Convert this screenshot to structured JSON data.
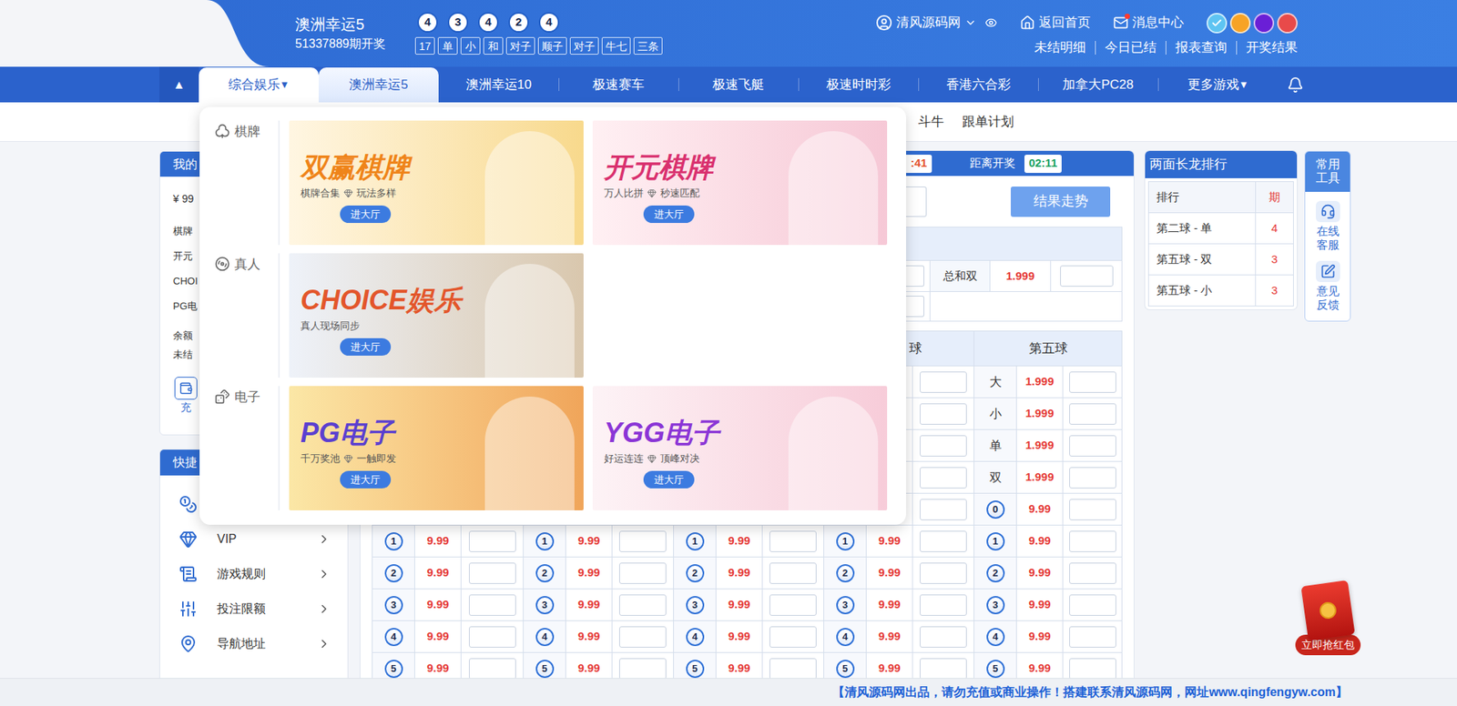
{
  "header": {
    "game_title": "澳洲幸运5",
    "draw_info": "51337889期开奖",
    "balls": [
      "4",
      "3",
      "4",
      "2",
      "4"
    ],
    "tags": [
      "17",
      "单",
      "小",
      "和",
      "对子",
      "顺子",
      "对子",
      "牛七",
      "三条"
    ],
    "user": "清风源码网",
    "home": "返回首页",
    "messages": "消息中心",
    "message_unread": true,
    "themes": [
      {
        "color": "#5ec4f2",
        "selected": true
      },
      {
        "color": "#f7a325",
        "selected": false
      },
      {
        "color": "#6a1fd6",
        "selected": false
      },
      {
        "color": "#e84a4a",
        "selected": false
      }
    ],
    "quick_links": [
      "未结明细",
      "今日已结",
      "报表查询",
      "开奖结果"
    ]
  },
  "nav": {
    "toggle": "▲",
    "items": [
      {
        "label": "综合娱乐",
        "arrow": "▼",
        "selected": false,
        "expanded": true
      },
      {
        "label": "澳洲幸运5",
        "selected": true
      },
      {
        "label": "澳洲幸运10",
        "selected": false
      },
      {
        "label": "极速赛车",
        "selected": false
      },
      {
        "label": "极速飞艇",
        "selected": false
      },
      {
        "label": "极速时时彩",
        "selected": false
      },
      {
        "label": "香港六合彩",
        "selected": false
      },
      {
        "label": "加拿大PC28",
        "selected": false
      },
      {
        "label": "更多游戏",
        "arrow": "▼",
        "selected": false,
        "expanded": false
      }
    ]
  },
  "subnav": [
    "斗牛",
    "跟单计划"
  ],
  "sidebar": {
    "account": {
      "title": "我的",
      "balance": "¥ 99",
      "games": [
        "棋牌",
        "开元",
        "CHOI",
        "PG电"
      ],
      "summary": [
        "余额",
        "未结"
      ],
      "recharge": "充"
    },
    "shortcuts": {
      "title": "快捷",
      "items": [
        {
          "kind": "coins"
        },
        {
          "kind": "vip",
          "label": "VIP"
        },
        {
          "kind": "rules",
          "label": "游戏规则"
        },
        {
          "kind": "limits",
          "label": "投注限额"
        },
        {
          "kind": "navigation",
          "label": "导航地址"
        }
      ]
    }
  },
  "dropdown": {
    "open": true,
    "categories": [
      {
        "kind": "cards",
        "label": "棋牌",
        "banners": [
          {
            "title": "双赢棋牌",
            "subtitle": [
              "棋牌合集",
              "玩法多样"
            ],
            "button": "进大厅",
            "color": "#ef8419"
          },
          {
            "title": "开元棋牌",
            "subtitle": [
              "万人比拼",
              "秒速匹配"
            ],
            "button": "进大厅",
            "color": "#d9306e"
          }
        ]
      },
      {
        "kind": "live",
        "label": "真人",
        "banners": [
          {
            "title": "CHOICE娱乐",
            "subtitle": [
              "真人现场同步"
            ],
            "button": "进大厅",
            "color": "#e3562b"
          }
        ]
      },
      {
        "kind": "slots",
        "label": "电子",
        "banners": [
          {
            "title": "PG电子",
            "subtitle": [
              "千万奖池",
              "一触即发"
            ],
            "button": "进大厅",
            "color": "#5a3fd0"
          },
          {
            "title": "YGG电子",
            "subtitle": [
              "好运连连",
              "顶峰对决"
            ],
            "button": "进大厅",
            "color": "#8b35d6"
          }
        ]
      }
    ]
  },
  "countdown": {
    "close_tail": ":41",
    "label": "距离开奖",
    "time": "02:11"
  },
  "trend_button": "结果走势",
  "totals": [
    {
      "label": "总和双",
      "odds": "1.999"
    }
  ],
  "bet_table": {
    "columns": [
      "",
      "",
      "",
      "球",
      "第五球"
    ],
    "rows": [
      {
        "kind": "text",
        "cells": [
          null,
          null,
          null,
          null,
          {
            "label": "大",
            "odds": "1.999"
          }
        ]
      },
      {
        "kind": "text",
        "cells": [
          null,
          null,
          null,
          null,
          {
            "label": "小",
            "odds": "1.999"
          }
        ]
      },
      {
        "kind": "text",
        "cells": [
          null,
          null,
          null,
          null,
          {
            "label": "单",
            "odds": "1.999"
          }
        ]
      },
      {
        "kind": "text",
        "cells": [
          null,
          null,
          null,
          null,
          {
            "label": "双",
            "odds": "1.999"
          }
        ]
      },
      {
        "kind": "ball",
        "cells": [
          null,
          null,
          null,
          null,
          {
            "label": "0",
            "odds": "9.99"
          }
        ]
      },
      {
        "kind": "ball",
        "cells": [
          {
            "label": "1",
            "odds": "9.99"
          },
          {
            "label": "1",
            "odds": "9.99"
          },
          {
            "label": "1",
            "odds": "9.99"
          },
          {
            "label": "1",
            "odds": "9.99"
          },
          {
            "label": "1",
            "odds": "9.99"
          }
        ]
      },
      {
        "kind": "ball",
        "cells": [
          {
            "label": "2",
            "odds": "9.99"
          },
          {
            "label": "2",
            "odds": "9.99"
          },
          {
            "label": "2",
            "odds": "9.99"
          },
          {
            "label": "2",
            "odds": "9.99"
          },
          {
            "label": "2",
            "odds": "9.99"
          }
        ]
      },
      {
        "kind": "ball",
        "cells": [
          {
            "label": "3",
            "odds": "9.99"
          },
          {
            "label": "3",
            "odds": "9.99"
          },
          {
            "label": "3",
            "odds": "9.99"
          },
          {
            "label": "3",
            "odds": "9.99"
          },
          {
            "label": "3",
            "odds": "9.99"
          }
        ]
      },
      {
        "kind": "ball",
        "cells": [
          {
            "label": "4",
            "odds": "9.99"
          },
          {
            "label": "4",
            "odds": "9.99"
          },
          {
            "label": "4",
            "odds": "9.99"
          },
          {
            "label": "4",
            "odds": "9.99"
          },
          {
            "label": "4",
            "odds": "9.99"
          }
        ]
      },
      {
        "kind": "ball",
        "cells": [
          {
            "label": "5",
            "odds": "9.99"
          },
          {
            "label": "5",
            "odds": "9.99"
          },
          {
            "label": "5",
            "odds": "9.99"
          },
          {
            "label": "5",
            "odds": "9.99"
          },
          {
            "label": "5",
            "odds": "9.99"
          }
        ]
      }
    ]
  },
  "long_dragon": {
    "title": "两面长龙排行",
    "columns": [
      "排行",
      "期"
    ],
    "rows": [
      {
        "label": "第二球 - 单",
        "count": "4"
      },
      {
        "label": "第五球 - 双",
        "count": "3"
      },
      {
        "label": "第五球 - 小",
        "count": "3"
      }
    ]
  },
  "tools": {
    "title": "常用工具",
    "items": [
      {
        "kind": "service",
        "label": "在线客服"
      },
      {
        "kind": "feedback",
        "label": "意见反馈"
      }
    ]
  },
  "red_packet": {
    "label": "立即抢红包"
  },
  "footer_notice": "【清风源码网出品，请勿充值或商业操作！搭建联系清风源码网，网址www.qingfengyw.com】"
}
